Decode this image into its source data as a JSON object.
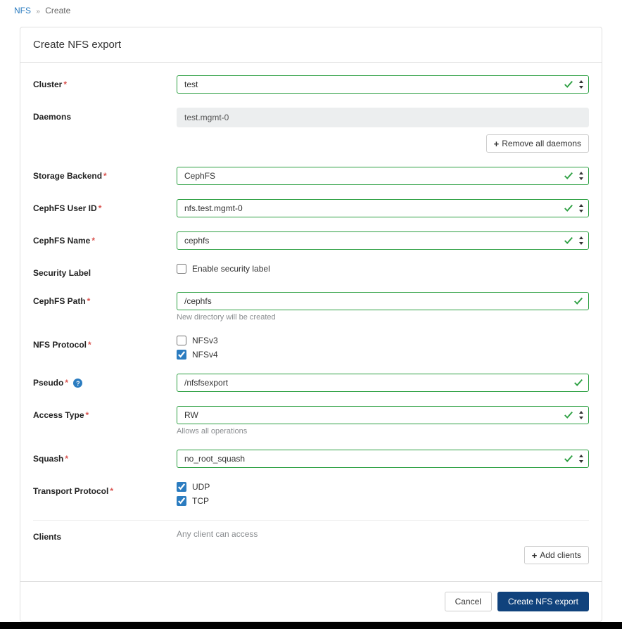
{
  "breadcrumb": {
    "root": "NFS",
    "current": "Create"
  },
  "title": "Create NFS export",
  "labels": {
    "cluster": "Cluster",
    "daemons": "Daemons",
    "storage_backend": "Storage Backend",
    "cephfs_user": "CephFS User ID",
    "cephfs_name": "CephFS Name",
    "security_label": "Security Label",
    "cephfs_path": "CephFS Path",
    "nfs_protocol": "NFS Protocol",
    "pseudo": "Pseudo",
    "access_type": "Access Type",
    "squash": "Squash",
    "transport": "Transport Protocol",
    "clients": "Clients"
  },
  "fields": {
    "cluster": {
      "value": "test"
    },
    "daemons": {
      "value": "test.mgmt-0"
    },
    "storage_backend": {
      "value": "CephFS"
    },
    "cephfs_user": {
      "value": "nfs.test.mgmt-0"
    },
    "cephfs_name": {
      "value": "cephfs"
    },
    "security_label_option": "Enable security label",
    "cephfs_path": {
      "value": "/cephfs",
      "hint": "New directory will be created"
    },
    "nfs_protocol": {
      "v3": "NFSv3",
      "v4": "NFSv4"
    },
    "pseudo": {
      "value": "/nfsfsexport"
    },
    "access_type": {
      "value": "RW",
      "hint": "Allows all operations"
    },
    "squash": {
      "value": "no_root_squash"
    },
    "transport": {
      "udp": "UDP",
      "tcp": "TCP"
    },
    "clients_hint": "Any client can access"
  },
  "buttons": {
    "remove_daemons": "Remove all daemons",
    "add_clients": "Add clients",
    "cancel": "Cancel",
    "submit": "Create NFS export"
  }
}
